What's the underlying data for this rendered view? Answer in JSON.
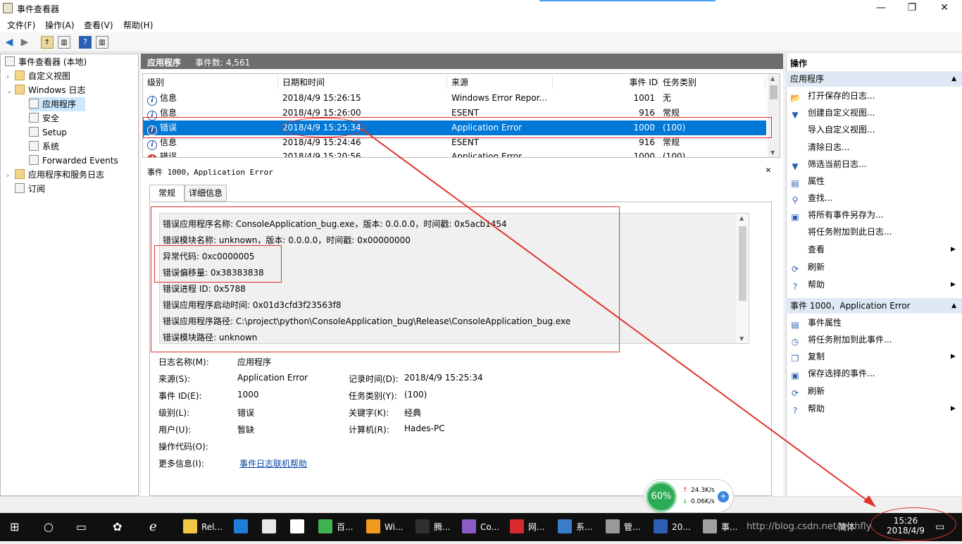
{
  "window": {
    "title": "事件查看器",
    "min_glyph": "—",
    "max_glyph": "❐",
    "close_glyph": "✕"
  },
  "menu": [
    "文件(F)",
    "操作(A)",
    "查看(V)",
    "帮助(H)"
  ],
  "tree": {
    "root": "事件查看器 (本地)",
    "items": [
      {
        "label": "自定义视图",
        "level": 1
      },
      {
        "label": "Windows 日志",
        "level": 1
      },
      {
        "label": "应用程序",
        "level": 2,
        "selected": true
      },
      {
        "label": "安全",
        "level": 2
      },
      {
        "label": "Setup",
        "level": 2
      },
      {
        "label": "系统",
        "level": 2
      },
      {
        "label": "Forwarded Events",
        "level": 2
      },
      {
        "label": "应用程序和服务日志",
        "level": 1
      },
      {
        "label": "订阅",
        "level": 1
      }
    ]
  },
  "list": {
    "title": "应用程序",
    "count_label": "事件数: 4,561",
    "columns": [
      "级别",
      "日期和时间",
      "来源",
      "事件 ID",
      "任务类别"
    ],
    "rows": [
      {
        "level_icon": "i",
        "level": "信息",
        "datetime": "2018/4/9 15:26:15",
        "source": "Windows Error Repor...",
        "id": "1001",
        "task": "无"
      },
      {
        "level_icon": "i",
        "level": "信息",
        "datetime": "2018/4/9 15:26:00",
        "source": "ESENT",
        "id": "916",
        "task": "常规"
      },
      {
        "level_icon": "!",
        "level": "错误",
        "datetime": "2018/4/9 15:25:34",
        "source": "Application Error",
        "id": "1000",
        "task": "(100)"
      },
      {
        "level_icon": "i",
        "level": "信息",
        "datetime": "2018/4/9 15:24:46",
        "source": "ESENT",
        "id": "916",
        "task": "常规"
      },
      {
        "level_icon": "!",
        "level": "错误",
        "datetime": "2018/4/9 15:20:56",
        "source": "Application Error",
        "id": "1000",
        "task": "(100)"
      }
    ]
  },
  "detail": {
    "header": "事件 1000，Application Error",
    "tabs": [
      "常规",
      "详细信息"
    ],
    "message": [
      "错误应用程序名称: ConsoleApplication_bug.exe，版本: 0.0.0.0，时间戳: 0x5acb1454",
      "错误模块名称: unknown，版本: 0.0.0.0，时间戳: 0x00000000",
      "异常代码: 0xc0000005",
      "错误偏移量: 0x38383838",
      "错误进程 ID: 0x5788",
      "错误应用程序启动时间: 0x01d3cfd3f23563f8",
      "错误应用程序路径: C:\\project\\python\\ConsoleApplication_bug\\Release\\ConsoleApplication_bug.exe",
      "错误模块路径: unknown"
    ],
    "props": {
      "logname_label": "日志名称(M):",
      "logname": "应用程序",
      "source_label": "来源(S):",
      "source": "Application Error",
      "recorded_label": "记录时间(D):",
      "recorded": "2018/4/9 15:25:34",
      "eventid_label": "事件 ID(E):",
      "eventid": "1000",
      "task_label": "任务类别(Y):",
      "task": "(100)",
      "level_label": "级别(L):",
      "level": "错误",
      "keywords_label": "关键字(K):",
      "keywords": "经典",
      "user_label": "用户(U):",
      "user": "暂缺",
      "computer_label": "计算机(R):",
      "computer": "Hades-PC",
      "opcode_label": "操作代码(O):",
      "moreinfo_label": "更多信息(I):",
      "moreinfo_link": "事件日志联机帮助"
    }
  },
  "actions": {
    "title": "操作",
    "section1": "应用程序",
    "items1": [
      {
        "label": "打开保存的日志...",
        "icon": "folder-open-icon",
        "glyph": "📂"
      },
      {
        "label": "创建自定义视图...",
        "icon": "filter-create-icon",
        "glyph": "▼"
      },
      {
        "label": "导入自定义视图...",
        "icon": "",
        "glyph": ""
      },
      {
        "label": "清除日志...",
        "icon": "",
        "glyph": ""
      },
      {
        "label": "筛选当前日志...",
        "icon": "filter-icon",
        "glyph": "▼"
      },
      {
        "label": "属性",
        "icon": "properties-icon",
        "glyph": "▤"
      },
      {
        "label": "查找...",
        "icon": "find-icon",
        "glyph": "⚲"
      },
      {
        "label": "将所有事件另存为...",
        "icon": "save-icon",
        "glyph": "▣"
      },
      {
        "label": "将任务附加到此日志...",
        "icon": "",
        "glyph": ""
      },
      {
        "label": "查看",
        "icon": "",
        "glyph": "",
        "submenu": true
      },
      {
        "label": "刷新",
        "icon": "refresh-icon",
        "glyph": "⟳"
      },
      {
        "label": "帮助",
        "icon": "help-icon",
        "glyph": "?",
        "submenu": true
      }
    ],
    "section2": "事件 1000，Application Error",
    "items2": [
      {
        "label": "事件属性",
        "icon": "event-properties-icon",
        "glyph": "▤"
      },
      {
        "label": "将任务附加到此事件...",
        "icon": "task-icon",
        "glyph": "◷"
      },
      {
        "label": "复制",
        "icon": "copy-icon",
        "glyph": "❐",
        "submenu": true
      },
      {
        "label": "保存选择的事件...",
        "icon": "save-icon",
        "glyph": "▣"
      },
      {
        "label": "刷新",
        "icon": "refresh-icon",
        "glyph": "⟳"
      },
      {
        "label": "帮助",
        "icon": "help-icon",
        "glyph": "?",
        "submenu": true
      }
    ]
  },
  "widget": {
    "percent": "60%",
    "up": "24.3K/s",
    "down": "0.06K/s"
  },
  "taskbar": {
    "apps": [
      {
        "label": "Rel...",
        "color": "#f2c744"
      },
      {
        "label": "",
        "color": "#1f7fd8"
      },
      {
        "label": "",
        "color": "#e8e8e8"
      },
      {
        "label": "",
        "color": "#ffffff"
      },
      {
        "label": "百...",
        "color": "#3fb34f"
      },
      {
        "label": "Wi...",
        "color": "#f29a1e"
      },
      {
        "label": "腾...",
        "color": "#2f2f2f"
      },
      {
        "label": "Co...",
        "color": "#8a5cc7"
      },
      {
        "label": "网...",
        "color": "#d8292d"
      },
      {
        "label": "系...",
        "color": "#3a7cc8"
      },
      {
        "label": "管...",
        "color": "#999999"
      },
      {
        "label": "20...",
        "color": "#2b5fb4"
      },
      {
        "label": "事...",
        "color": "#a0a0a0"
      }
    ],
    "ime": "简体",
    "time": "15:26",
    "date": "2018/4/9",
    "watermark": "http://blog.csdn.net/wishfly"
  },
  "colors": {
    "selection": "#0078d7",
    "annotation": "#e0322d"
  }
}
